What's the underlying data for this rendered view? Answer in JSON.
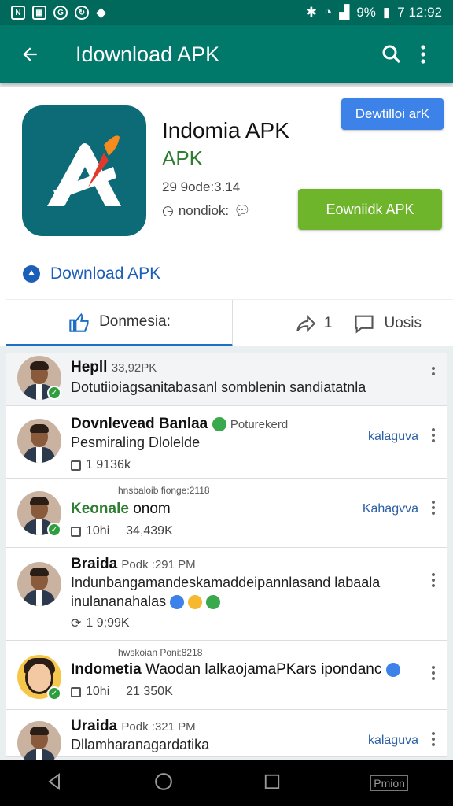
{
  "status_bar": {
    "time": "7 12:92",
    "battery": "9%"
  },
  "app_bar": {
    "title": "Idownload APK"
  },
  "app": {
    "name": "Indomia APK",
    "subtitle": "APK",
    "meta": "29 9ode:3.14",
    "developer": "nondiok:",
    "download_small_label": "Dewtilloi arK",
    "download_main_label": "Eowniidk APK",
    "download_link": "Download APK",
    "like_label": "Donmesia:",
    "share_count": "1",
    "comments_label": "Uosis"
  },
  "feed": [
    {
      "name": "Hepll",
      "meta": "33,92PK",
      "line": "Dotutiioiagsanitabasanl somblenin sandiatatnla"
    },
    {
      "name": "Dovnlevead Banlaa",
      "tag": "Poturekerd",
      "line": "Pesmiraling Dlolelde",
      "stat": "1 9136k",
      "side": "kalaguva"
    },
    {
      "header": "hnsbaloib fionge:2118",
      "name": "Keonale",
      "name2": "onom",
      "stat1": "10hi",
      "stat2": "34,439K",
      "side": "Kahagvva"
    },
    {
      "name": "Braida",
      "meta": "Podk :291 PM",
      "line": "Indunbangamandeskamaddeipannlasand labaala",
      "line2": "inulananahalas",
      "stat": "1 9;99K"
    },
    {
      "header": "hwskoian Poni:8218",
      "name": "Indometia",
      "line": "Waodan lalkaojamaPKars ipondanc",
      "stat1": "10hi",
      "stat2": "21 350K"
    },
    {
      "name": "Uraida",
      "meta": "Podk :321 PM",
      "line": "Dllamharanagardatika",
      "side": "kalaguva"
    }
  ],
  "nav": {
    "recent_label": "Pmion"
  },
  "colors": {
    "primary": "#00796b",
    "status": "#00695c",
    "blue_button": "#3d82e8",
    "green_button": "#6fb52c",
    "link": "#1c5fb8"
  }
}
